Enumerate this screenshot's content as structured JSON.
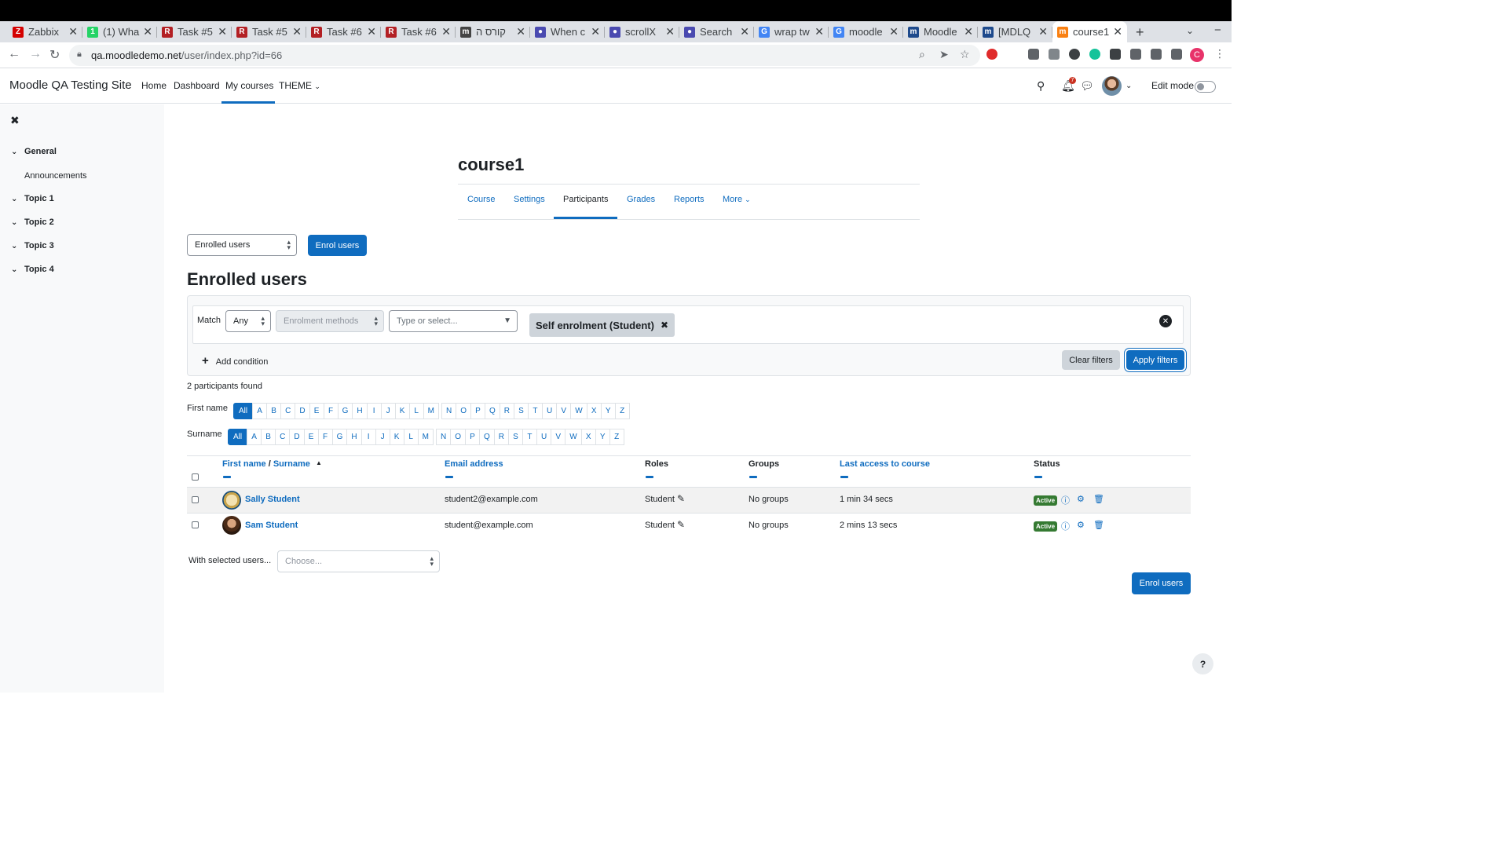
{
  "browser": {
    "tabs": [
      {
        "title": "Zabbix",
        "favicon": "zabbix-icon",
        "fav_color": "#d40000",
        "fav_glyph": "Z"
      },
      {
        "title": "(1) Wha",
        "favicon": "whatsapp-icon",
        "fav_color": "#25d366",
        "fav_glyph": "1"
      },
      {
        "title": "Task #5",
        "favicon": "redmine-icon",
        "fav_color": "#b32024",
        "fav_glyph": "R"
      },
      {
        "title": "Task #5",
        "favicon": "redmine-icon",
        "fav_color": "#b32024",
        "fav_glyph": "R"
      },
      {
        "title": "Task #6",
        "favicon": "redmine-icon",
        "fav_color": "#b32024",
        "fav_glyph": "R"
      },
      {
        "title": "Task #6",
        "favicon": "redmine-icon",
        "fav_color": "#b32024",
        "fav_glyph": "R"
      },
      {
        "title": "קורס ה",
        "favicon": "moodle-icon",
        "fav_color": "#444444",
        "fav_glyph": "m"
      },
      {
        "title": "When c",
        "favicon": "globe-icon",
        "fav_color": "#4a4ab0",
        "fav_glyph": "●"
      },
      {
        "title": "scrollX",
        "favicon": "globe-icon",
        "fav_color": "#4a4ab0",
        "fav_glyph": "●"
      },
      {
        "title": "Search",
        "favicon": "globe-icon",
        "fav_color": "#4a4ab0",
        "fav_glyph": "●"
      },
      {
        "title": "wrap tw",
        "favicon": "google-icon",
        "fav_color": "#4285f4",
        "fav_glyph": "G"
      },
      {
        "title": "moodle",
        "favicon": "google-icon",
        "fav_color": "#4285f4",
        "fav_glyph": "G"
      },
      {
        "title": "Moodle",
        "favicon": "moodle-tracker-icon",
        "fav_color": "#1e4a8c",
        "fav_glyph": "m"
      },
      {
        "title": "[MDLQ",
        "favicon": "moodle-tracker-icon",
        "fav_color": "#1e4a8c",
        "fav_glyph": "m"
      },
      {
        "title": "course1",
        "favicon": "moodle-icon",
        "fav_color": "#f98012",
        "fav_glyph": "m",
        "active": true
      }
    ],
    "url_host": "qa.moodledemo.net",
    "url_path": "/user/index.php?id=66",
    "profile_initial": "C"
  },
  "navbar": {
    "site_name": "Moodle QA Testing Site",
    "items": [
      "Home",
      "Dashboard",
      "My courses",
      "THEME"
    ],
    "active_item": "My courses",
    "notification_count": "7",
    "edit_mode_label": "Edit mode"
  },
  "drawer": {
    "sections": [
      {
        "label": "General",
        "items": [
          "Announcements"
        ]
      },
      {
        "label": "Topic 1",
        "items": []
      },
      {
        "label": "Topic 2",
        "items": []
      },
      {
        "label": "Topic 3",
        "items": []
      },
      {
        "label": "Topic 4",
        "items": []
      }
    ]
  },
  "course": {
    "title": "course1",
    "tabs": [
      "Course",
      "Settings",
      "Participants",
      "Grades",
      "Reports",
      "More"
    ],
    "active_tab": "Participants"
  },
  "participants": {
    "view_select": "Enrolled users",
    "enrol_button": "Enrol users",
    "heading": "Enrolled users",
    "filter": {
      "match_label": "Match",
      "match_value": "Any",
      "type_select": "Enrolment methods",
      "value_placeholder": "Type or select...",
      "chip": "Self enrolment (Student)",
      "add_condition": "Add condition",
      "clear": "Clear filters",
      "apply": "Apply filters"
    },
    "found_text": "2 participants found",
    "first_name_label": "First name",
    "surname_label": "Surname",
    "letters_all": "All",
    "letters": [
      "A",
      "B",
      "C",
      "D",
      "E",
      "F",
      "G",
      "H",
      "I",
      "J",
      "K",
      "L",
      "M",
      "N",
      "O",
      "P",
      "Q",
      "R",
      "S",
      "T",
      "U",
      "V",
      "W",
      "X",
      "Y",
      "Z"
    ],
    "table": {
      "col_first": "First name",
      "col_sep": "/",
      "col_surname": "Surname",
      "col_email": "Email address",
      "col_roles": "Roles",
      "col_groups": "Groups",
      "col_last_access": "Last access to course",
      "col_status": "Status",
      "rows": [
        {
          "name": "Sally Student",
          "email": "student2@example.com",
          "role": "Student",
          "groups": "No groups",
          "last_access": "1 min 34 secs",
          "status": "Active"
        },
        {
          "name": "Sam Student",
          "email": "student@example.com",
          "role": "Student",
          "groups": "No groups",
          "last_access": "2 mins 13 secs",
          "status": "Active"
        }
      ]
    },
    "bulk_label": "With selected users...",
    "bulk_placeholder": "Choose...",
    "enrol_button_bottom": "Enrol users"
  },
  "help_label": "?",
  "colors": {
    "brand": "#0f6cbf",
    "success": "#357a32",
    "drawer_bg": "#f8f9fa"
  }
}
